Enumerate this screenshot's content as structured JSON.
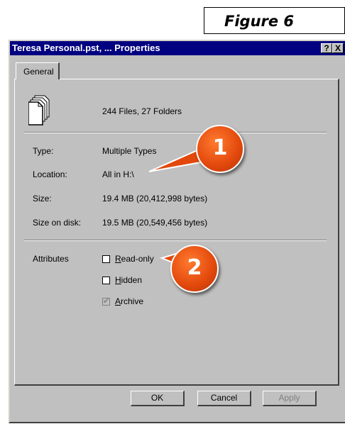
{
  "figure_label": "Figure 6",
  "window": {
    "title": "Teresa Personal.pst, ... Properties",
    "help_btn": "?",
    "close_btn": "X"
  },
  "tabs": [
    {
      "label": "General"
    }
  ],
  "summary": "244 Files, 27 Folders",
  "properties": {
    "type_label": "Type:",
    "type_value": "Multiple Types",
    "location_label": "Location:",
    "location_value": "All in H:\\",
    "size_label": "Size:",
    "size_value": "19.4 MB (20,412,998 bytes)",
    "size_on_disk_label": "Size on disk:",
    "size_on_disk_value": "19.5 MB (20,549,456 bytes)"
  },
  "attributes": {
    "label": "Attributes",
    "readonly": {
      "u": "R",
      "rest": "ead-only",
      "checked": false
    },
    "hidden": {
      "u": "H",
      "rest": "idden",
      "checked": false
    },
    "archive": {
      "u": "A",
      "rest": "rchive",
      "checked": true,
      "disabled": true
    }
  },
  "buttons": {
    "ok": "OK",
    "cancel": "Cancel",
    "apply": "Apply"
  },
  "callouts": [
    "1",
    "2"
  ],
  "colors": {
    "titlebar": "#000080",
    "dialog": "#c0c0c0",
    "callout": "#e2480c"
  }
}
